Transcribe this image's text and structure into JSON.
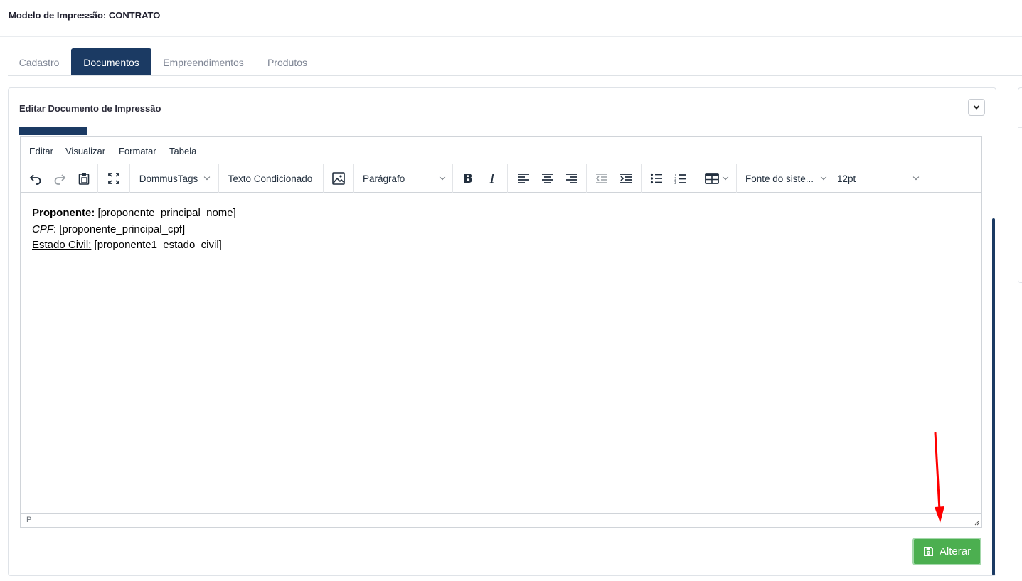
{
  "page": {
    "title": "Modelo de Impressão: CONTRATO"
  },
  "tabs": [
    {
      "label": "Cadastro",
      "active": false
    },
    {
      "label": "Documentos",
      "active": true
    },
    {
      "label": "Empreendimentos",
      "active": false
    },
    {
      "label": "Produtos",
      "active": false
    }
  ],
  "card": {
    "title": "Editar Documento de Impressão"
  },
  "editor": {
    "menu": [
      "Editar",
      "Visualizar",
      "Formatar",
      "Tabela"
    ],
    "toolbar": {
      "tags_label": "DommusTags",
      "conditional_label": "Texto Condicionado",
      "block_format": "Parágrafo",
      "font_family": "Fonte do siste...",
      "font_size": "12pt"
    },
    "content": {
      "line1_label": "Proponente:",
      "line1_value": " [proponente_principal_nome]",
      "line2_label": "CPF",
      "line2_value": ": [proponente_principal_cpf]",
      "line3_label": "Estado Civil:",
      "line3_value": " [proponente1_estado_civil]"
    },
    "status_path": "P"
  },
  "actions": {
    "save_label": "Alterar"
  },
  "colors": {
    "primary": "#1b3a63",
    "success": "#4caf50",
    "annotation": "#ff0000"
  }
}
